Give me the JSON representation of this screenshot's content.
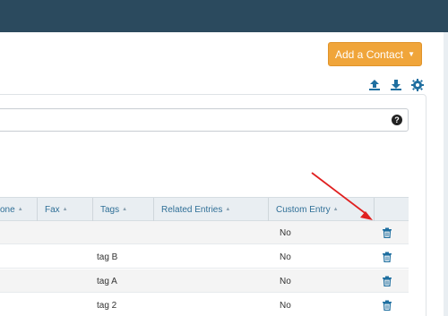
{
  "header": {
    "add_button_label": "Add a Contact"
  },
  "toolbar_icons": [
    "upload-icon",
    "download-icon",
    "gear-icon"
  ],
  "table": {
    "columns": [
      "one",
      "Fax",
      "Tags",
      "Related Entries",
      "Custom Entry"
    ],
    "rows": [
      {
        "tags": "",
        "custom_entry": "No"
      },
      {
        "tags": "tag B",
        "custom_entry": "No"
      },
      {
        "tags": "tag A",
        "custom_entry": "No"
      },
      {
        "tags": "tag 2",
        "custom_entry": "No"
      }
    ]
  },
  "colors": {
    "topbar": "#2b4a5e",
    "accent_button": "#f0a53a",
    "link": "#2f6f97",
    "arrow": "#e02020"
  }
}
